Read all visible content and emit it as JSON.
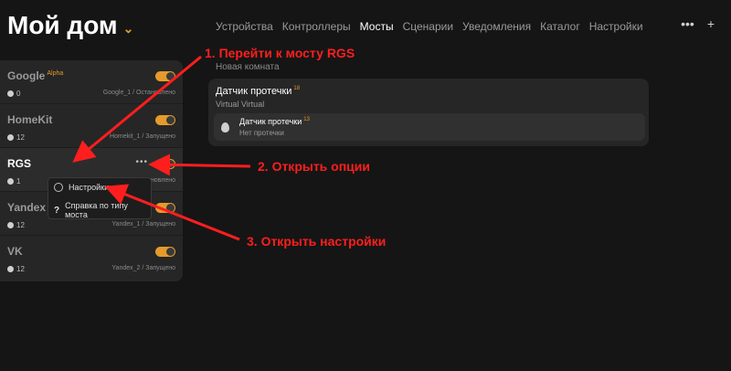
{
  "header": {
    "title": "Мой дом",
    "nav": [
      "Устройства",
      "Контроллеры",
      "Мосты",
      "Сценарии",
      "Уведомления",
      "Каталог",
      "Настройки"
    ],
    "active_nav": "Мосты",
    "more": "•••",
    "add": "+"
  },
  "bridges": [
    {
      "name": "Google",
      "badge": "Alpha",
      "count": "0",
      "status": "Google_1 / Остановлено"
    },
    {
      "name": "HomeKit",
      "badge": "",
      "count": "12",
      "status": "Homekit_1 / Запущено"
    },
    {
      "name": "RGS",
      "badge": "",
      "count": "1",
      "status": "вновлено"
    },
    {
      "name": "Yandex",
      "badge": "",
      "count": "12",
      "status": "Yandex_1 / Запущено"
    },
    {
      "name": "VK",
      "badge": "",
      "count": "12",
      "status": "Yandex_2 / Запущено"
    }
  ],
  "rgs_dots": "•••",
  "menu": {
    "settings": "Настройки",
    "help": "Справка по типу моста"
  },
  "room": {
    "label": "Новая комната",
    "card_title": "Датчик протечки",
    "card_count": "18",
    "card_sub": "Virtual Virtual",
    "inner_title": "Датчик протечки",
    "inner_count": "13",
    "inner_status": "Нет протечки"
  },
  "annotations": {
    "a1": "1. Перейти к мосту RGS",
    "a2": "2. Открыть опции",
    "a3": "3. Открыть настройки"
  },
  "colors": {
    "accent": "#e49b2b",
    "annotation": "#ff1e1e",
    "background": "#151515"
  }
}
